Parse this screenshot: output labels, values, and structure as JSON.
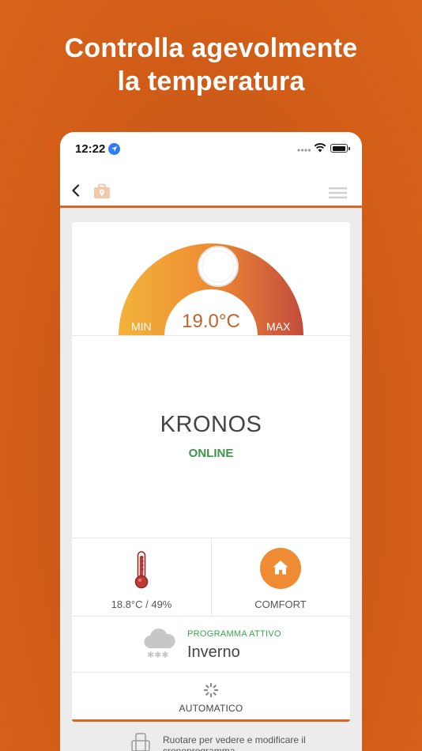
{
  "headline": {
    "line1": "Controlla agevolmente",
    "line2": "la temperatura"
  },
  "status_bar": {
    "time": "12:22",
    "icons": [
      "location-arrow-icon",
      "signal-icon",
      "wifi-icon",
      "battery-icon"
    ]
  },
  "nav": {
    "icons": [
      "back-chevron-icon",
      "toolbox-location-icon",
      "hamburger-menu-icon"
    ]
  },
  "gauge": {
    "min_label": "MIN",
    "max_label": "MAX",
    "setpoint": "19.0°C",
    "colors": [
      "#f2b43a",
      "#ee8b33",
      "#c24c3d"
    ]
  },
  "device": {
    "name": "KRONOS",
    "status": "ONLINE",
    "status_color": "#3b9447"
  },
  "reading": {
    "value": "18.8°C / 49%",
    "icon": "thermometer-icon"
  },
  "mode": {
    "label": "COMFORT",
    "icon": "home-icon",
    "accent": "#ee8b33"
  },
  "program": {
    "label": "PROGRAMMA ATTIVO",
    "value": "Inverno",
    "icon": "snow-cloud-icon"
  },
  "automatic": {
    "label": "AUTOMATICO",
    "icon": "spinner-icon"
  },
  "rotate_hint": {
    "text": "Ruotare per vedere e modificare il cronoprogramma",
    "icon": "rotate-device-icon"
  },
  "colors": {
    "brand_orange": "#d35e18",
    "accent_line": "#d7682a"
  }
}
